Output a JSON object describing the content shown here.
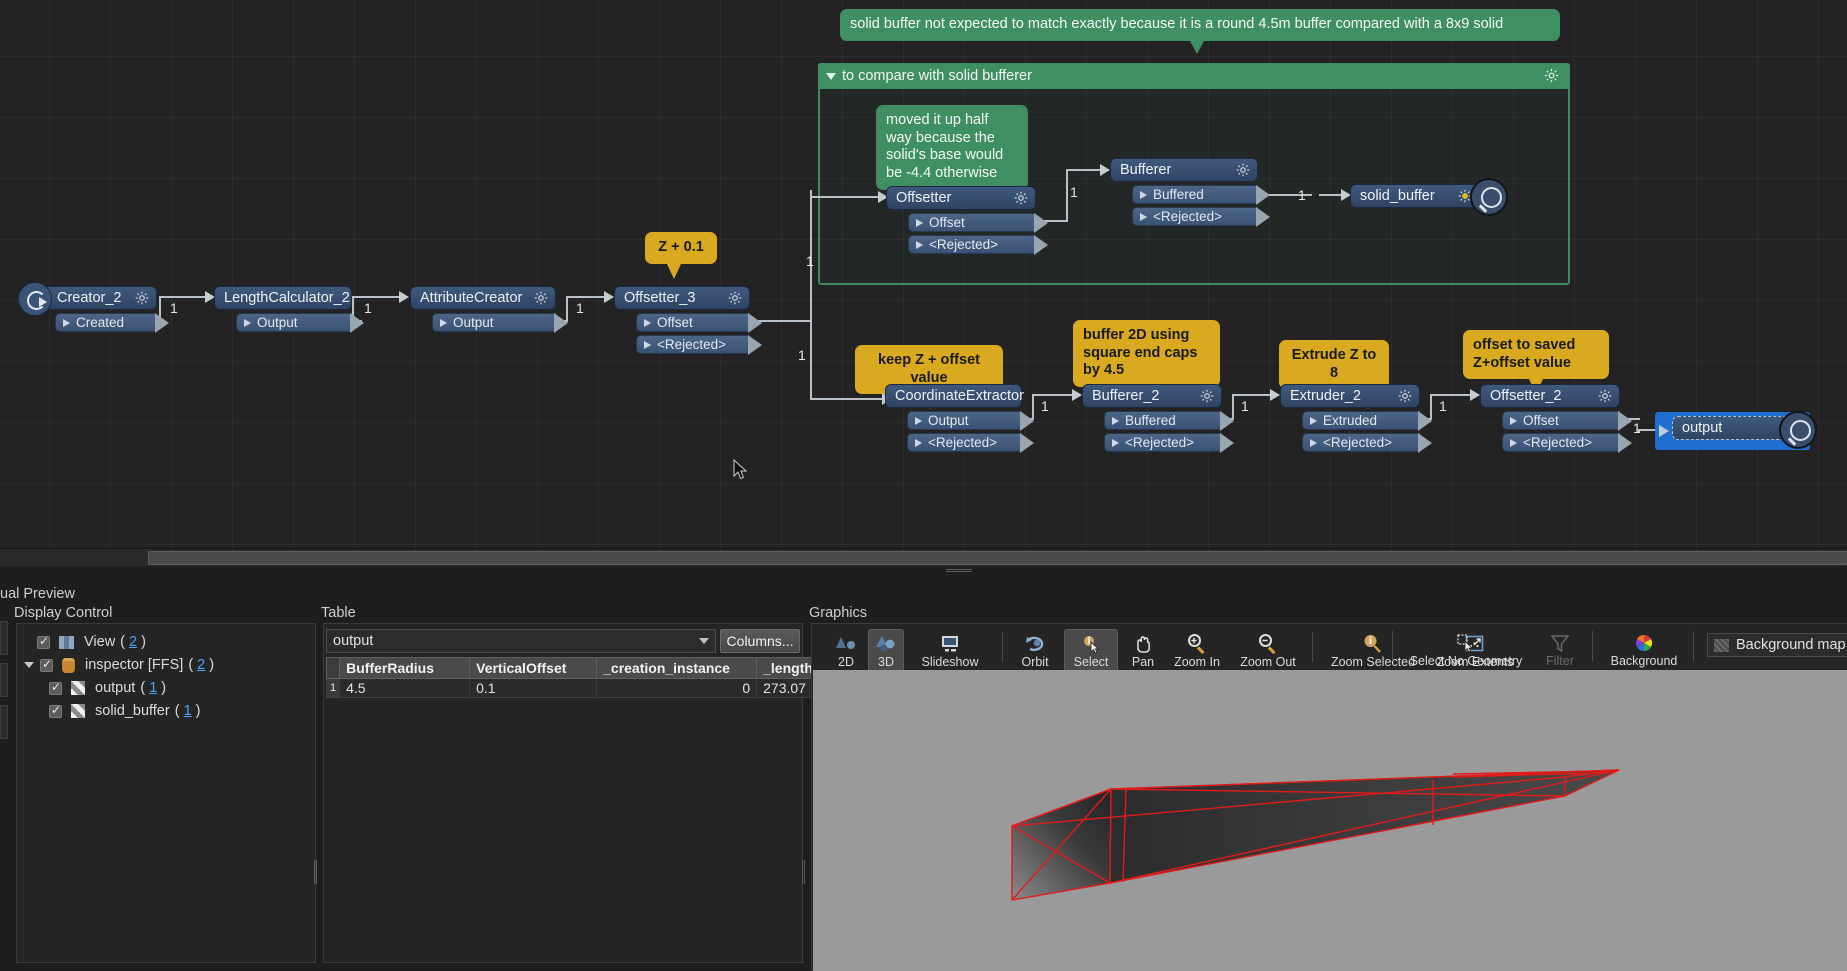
{
  "workspace": {
    "bookmark": {
      "title": "to compare with solid bufferer",
      "gear": "gear-icon"
    },
    "notes": [
      {
        "id": "note_solid",
        "text": "solid buffer not expected to match exactly because it is a round 4.5m buffer compared with a 8x9 solid",
        "color": "#3f8f62"
      },
      {
        "id": "note_moved",
        "text": "moved it up half way because the solid's base would be -4.4 otherwise",
        "color": "#3f8f62"
      },
      {
        "id": "note_z01",
        "text": "Z + 0.1",
        "color": "#d9a91f"
      },
      {
        "id": "note_keepz",
        "text": "keep Z + offset value",
        "color": "#d9a91f"
      },
      {
        "id": "note_buffer2d",
        "text": "buffer 2D using square end caps by 4.5",
        "color": "#d9a91f"
      },
      {
        "id": "note_extrude",
        "text": "Extrude Z to 8",
        "color": "#d9a91f"
      },
      {
        "id": "note_offsetsaved",
        "text": "offset to saved Z+offset value",
        "color": "#d9a91f"
      }
    ],
    "nodes": [
      {
        "id": "creator_2",
        "title": "Creator_2",
        "ports": [
          "Created"
        ]
      },
      {
        "id": "lengthcalc",
        "title": "LengthCalculator_2",
        "ports": [
          "Output"
        ]
      },
      {
        "id": "attrcreator",
        "title": "AttributeCreator",
        "ports": [
          "Output"
        ]
      },
      {
        "id": "offsetter_3",
        "title": "Offsetter_3",
        "ports": [
          "Offset",
          "<Rejected>"
        ]
      },
      {
        "id": "offsetter",
        "title": "Offsetter",
        "ports": [
          "Offset",
          "<Rejected>"
        ]
      },
      {
        "id": "bufferer",
        "title": "Bufferer",
        "ports": [
          "Buffered",
          "<Rejected>"
        ]
      },
      {
        "id": "solid_buffer",
        "title": "solid_buffer",
        "ports": []
      },
      {
        "id": "coordextr",
        "title": "CoordinateExtractor",
        "ports": [
          "Output",
          "<Rejected>"
        ]
      },
      {
        "id": "bufferer_2",
        "title": "Bufferer_2",
        "ports": [
          "Buffered",
          "<Rejected>"
        ]
      },
      {
        "id": "extruder_2",
        "title": "Extruder_2",
        "ports": [
          "Extruded",
          "<Rejected>"
        ]
      },
      {
        "id": "offsetter_2",
        "title": "Offsetter_2",
        "ports": [
          "Offset",
          "<Rejected>"
        ]
      },
      {
        "id": "output",
        "title": "output",
        "ports": []
      }
    ],
    "edge_labels": [
      "1",
      "1",
      "1",
      "1",
      "1",
      "1",
      "1",
      "1",
      "1",
      "1"
    ]
  },
  "dock": {
    "tab_title": "ual Preview",
    "display_control": {
      "title": "Display Control",
      "rows": [
        {
          "label": "View",
          "count": "2",
          "icon": "view-icon",
          "depth": 0,
          "checked": true,
          "twisty": false
        },
        {
          "label": "inspector [FFS]",
          "count": "2",
          "icon": "dataset-icon",
          "depth": 1,
          "checked": true,
          "twisty": true
        },
        {
          "label": "output",
          "count": "1",
          "icon": "feature-grid-icon",
          "depth": 2,
          "checked": true,
          "twisty": false
        },
        {
          "label": "solid_buffer",
          "count": "1",
          "icon": "feature-grid-icon",
          "depth": 2,
          "checked": true,
          "twisty": false
        }
      ]
    },
    "table": {
      "title": "Table",
      "selected_dataset": "output",
      "columns_button": "Columns...",
      "headers": [
        "BufferRadius",
        "VerticalOffset",
        "_creation_instance",
        "_length"
      ],
      "rows": [
        {
          "index": "1",
          "cells": [
            "4.5",
            "0.1",
            "0",
            "273.07"
          ]
        }
      ]
    },
    "graphics": {
      "title": "Graphics",
      "tools": [
        {
          "label": "2D",
          "icon": "shapes-2d-icon",
          "active": false
        },
        {
          "label": "3D",
          "icon": "shapes-3d-icon",
          "active": true
        },
        {
          "label": "Slideshow",
          "icon": "slideshow-icon",
          "active": false
        },
        {
          "label": "Orbit",
          "icon": "orbit-icon",
          "active": false
        },
        {
          "label": "Select",
          "icon": "select-cursor-icon",
          "active": true
        },
        {
          "label": "Pan",
          "icon": "hand-icon",
          "active": false
        },
        {
          "label": "Zoom In",
          "icon": "zoom-in-icon",
          "active": false
        },
        {
          "label": "Zoom Out",
          "icon": "zoom-out-icon",
          "active": false
        },
        {
          "label": "Zoom Selected",
          "icon": "zoom-selected-icon",
          "active": false
        },
        {
          "label": "Zoom Extents",
          "icon": "zoom-extents-icon",
          "active": false
        },
        {
          "label": "Select No Geometry",
          "icon": "select-no-geometry-icon",
          "active": false
        },
        {
          "label": "Filter",
          "icon": "filter-icon",
          "active": false,
          "disabled": true
        },
        {
          "label": "Background",
          "icon": "color-wheel-icon",
          "active": false
        }
      ],
      "background_map": "Background map off"
    }
  }
}
